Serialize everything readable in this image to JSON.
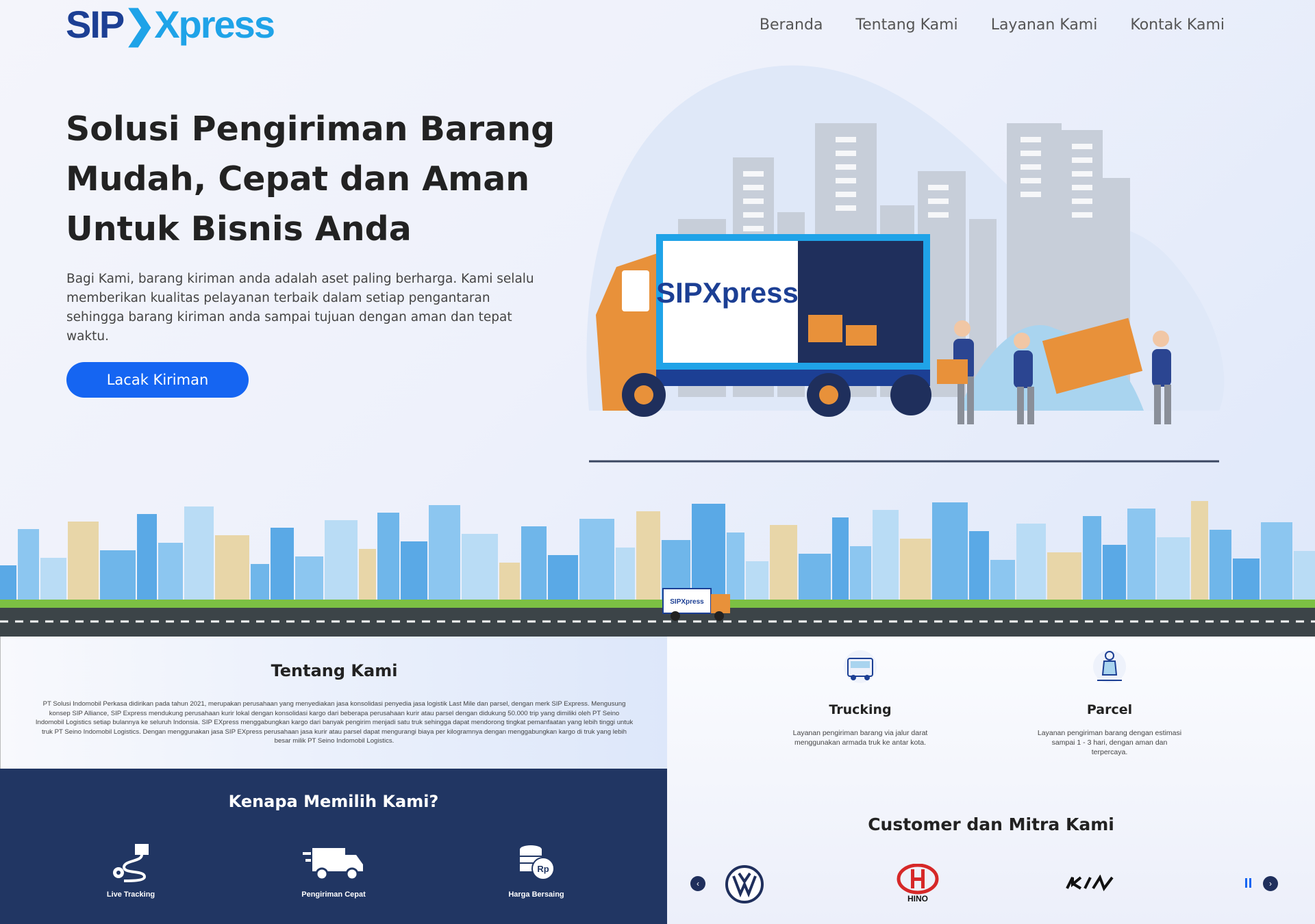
{
  "header": {
    "logo_sip": "SIP",
    "logo_chevron": "❯",
    "logo_xpress": "Xpress",
    "nav": [
      "Beranda",
      "Tentang Kami",
      "Layanan Kami",
      "Kontak Kami"
    ]
  },
  "hero": {
    "title": "Solusi Pengiriman Barang Mudah, Cepat dan Aman Untuk Bisnis Anda",
    "description": "Bagi Kami, barang kiriman anda adalah aset paling berharga. Kami selalu memberikan kualitas pelayanan terbaik dalam setiap pengantaran sehingga barang kiriman anda sampai tujuan dengan aman dan tepat waktu.",
    "cta": "Lacak Kiriman",
    "truck_brand": "SIPXpress",
    "mini_truck_brand": "SIPXpress"
  },
  "about": {
    "title": "Tentang Kami",
    "text": "PT Solusi Indomobil Perkasa didirikan pada tahun 2021, merupakan perusahaan yang menyediakan jasa konsolidasi penyedia jasa logistik Last Mile dan parsel, dengan merk SIP Express. Mengusung konsep SIP Alliance, SIP Express mendukung perusahaan kurir lokal dengan konsolidasi kargo dari beberapa perusahaan kurir atau parsel dengan didukung 50.000 trip yang dimiliki oleh PT Seino Indomobil Logistics setiap bulannya ke seluruh Indonsia. SIP EXpress menggabungkan kargo dari banyak pengirim menjadi satu truk sehingga dapat mendorong tingkat pemanfaatan yang lebih tinggi untuk truk PT Seino Indomobil Logistics. Dengan menggunakan jasa SIP EXpress perusahaan jasa kurir atau parsel dapat mengurangi biaya per kilogramnya dengan menggabungkan kargo di truk yang lebih besar milik PT Seino Indomobil Logistics."
  },
  "why": {
    "title": "Kenapa Memilih Kami?",
    "items": [
      {
        "icon": "live-tracking-icon",
        "label": "Live Tracking"
      },
      {
        "icon": "fast-delivery-truck-icon",
        "label": "Pengiriman Cepat"
      },
      {
        "icon": "coins-rp-icon",
        "label": "Harga Bersaing"
      }
    ]
  },
  "services": [
    {
      "icon": "trucking-icon",
      "title": "Trucking",
      "text": "Layanan pengiriman barang via jalur darat menggunakan armada truk ke antar kota."
    },
    {
      "icon": "parcel-icon",
      "title": "Parcel",
      "text": "Layanan pengiriman barang dengan estimasi sampai 1 - 3 hari, dengan aman dan terpercaya."
    }
  ],
  "partners": {
    "title": "Customer dan Mitra Kami",
    "logos": [
      "VW",
      "HINO",
      "KIA"
    ],
    "prev": "‹",
    "next": "›"
  },
  "colors": {
    "primary": "#1565f2",
    "navy": "#213663",
    "brand_dark": "#1c3f94",
    "brand_light": "#1fa3e8",
    "truck_orange": "#e8913a"
  }
}
